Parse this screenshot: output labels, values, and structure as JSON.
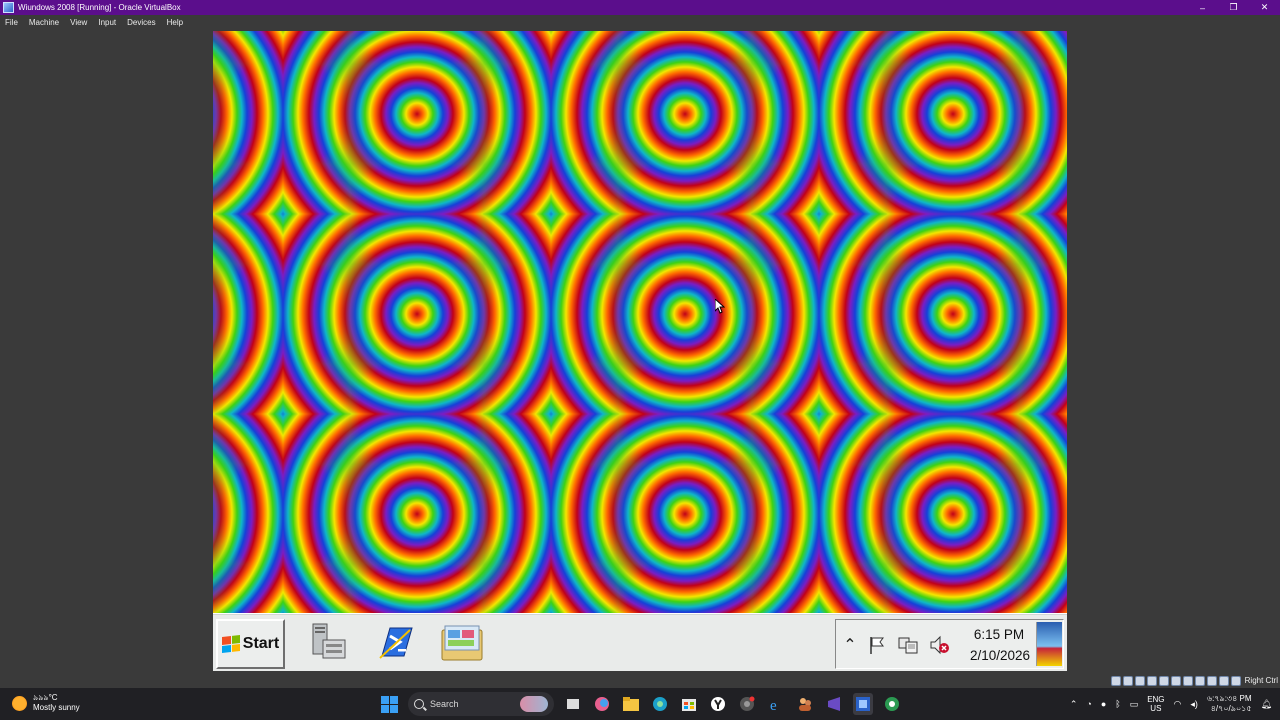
{
  "vbox": {
    "title": "Wiundows 2008 [Running] - Oracle VirtualBox",
    "menu": [
      "File",
      "Machine",
      "View",
      "Input",
      "Devices",
      "Help"
    ],
    "window_controls": {
      "minimize": "–",
      "restore": "❐",
      "close": "✕"
    },
    "host_key": "Right Ctrl"
  },
  "guest": {
    "start_label": "Start",
    "quick_launch": [
      "server-manager-icon",
      "powershell-icon",
      "windows-explorer-icon"
    ],
    "tray": {
      "expand": "⌃",
      "time": "6:15 PM",
      "date": "2/10/2026"
    }
  },
  "host": {
    "weather": {
      "temp": "৯৯৯°C",
      "condition": "Mostly sunny"
    },
    "search_placeholder": "Search",
    "lang": {
      "code": "ENG",
      "region": "US"
    },
    "clock": {
      "time": "৬:৭৯:৩৪ PM",
      "date": "৪/৭০/৯০১৫"
    },
    "colors": {
      "titlebar": "#5b0e8c",
      "taskbar": "#202024",
      "guest_taskbar": "#e9ebea"
    }
  }
}
